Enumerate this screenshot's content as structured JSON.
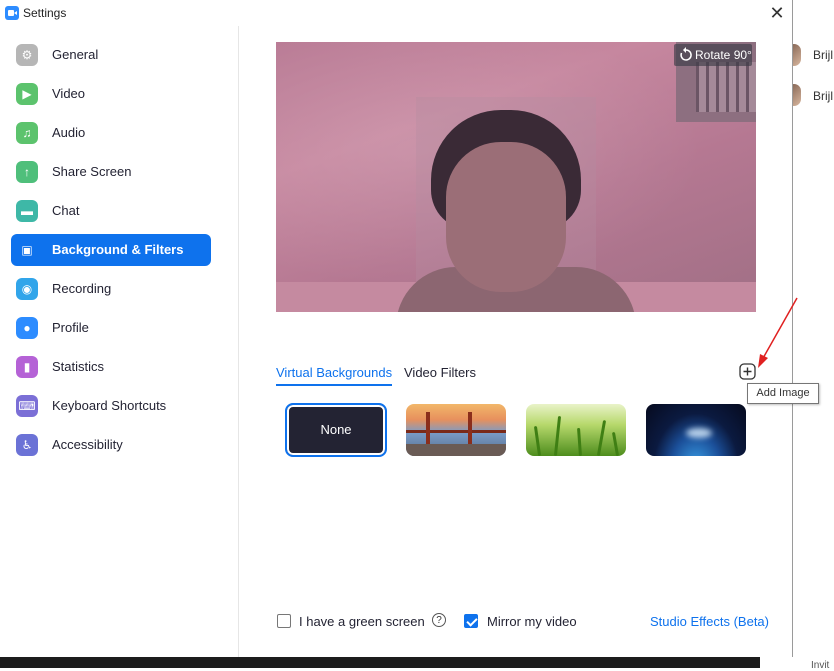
{
  "window": {
    "title": "Settings",
    "close_label": "✕"
  },
  "sidebar": {
    "items": [
      {
        "label": "General",
        "icon": "gear-icon",
        "color": "#b6b6b6",
        "glyph": "⚙"
      },
      {
        "label": "Video",
        "icon": "video-camera-icon",
        "color": "#5cc36d",
        "glyph": "▶"
      },
      {
        "label": "Audio",
        "icon": "headphones-icon",
        "color": "#5cc36d",
        "glyph": "♫"
      },
      {
        "label": "Share Screen",
        "icon": "share-screen-icon",
        "color": "#4fbf7b",
        "glyph": "↑"
      },
      {
        "label": "Chat",
        "icon": "chat-icon",
        "color": "#3eb8a7",
        "glyph": "▬"
      },
      {
        "label": "Background & Filters",
        "icon": "background-icon",
        "color": "#0e72ed",
        "glyph": "▣"
      },
      {
        "label": "Recording",
        "icon": "recording-icon",
        "color": "#31a5ea",
        "glyph": "◉"
      },
      {
        "label": "Profile",
        "icon": "profile-icon",
        "color": "#2d8cff",
        "glyph": "●"
      },
      {
        "label": "Statistics",
        "icon": "statistics-icon",
        "color": "#b562d6",
        "glyph": "▮"
      },
      {
        "label": "Keyboard Shortcuts",
        "icon": "keyboard-icon",
        "color": "#7b6fd6",
        "glyph": "⌨"
      },
      {
        "label": "Accessibility",
        "icon": "accessibility-icon",
        "color": "#6b72d6",
        "glyph": "♿"
      }
    ],
    "active_index": 5
  },
  "preview": {
    "rotate_label": "Rotate 90°"
  },
  "tabs": {
    "virtual_backgrounds": "Virtual Backgrounds",
    "video_filters": "Video Filters"
  },
  "add_image": {
    "tooltip": "Add Image"
  },
  "backgrounds": {
    "none_label": "None"
  },
  "options": {
    "green_screen_label": "I have a green screen",
    "green_screen_checked": false,
    "mirror_label": "Mirror my video",
    "mirror_checked": true,
    "studio_effects_label": "Studio Effects (Beta)",
    "help_glyph": "?"
  },
  "background_app": {
    "participants": [
      "Brijl",
      "Brijl"
    ],
    "invite_label": "Invit"
  },
  "colors": {
    "accent": "#0e72ed",
    "annotation_arrow": "#e02020"
  }
}
